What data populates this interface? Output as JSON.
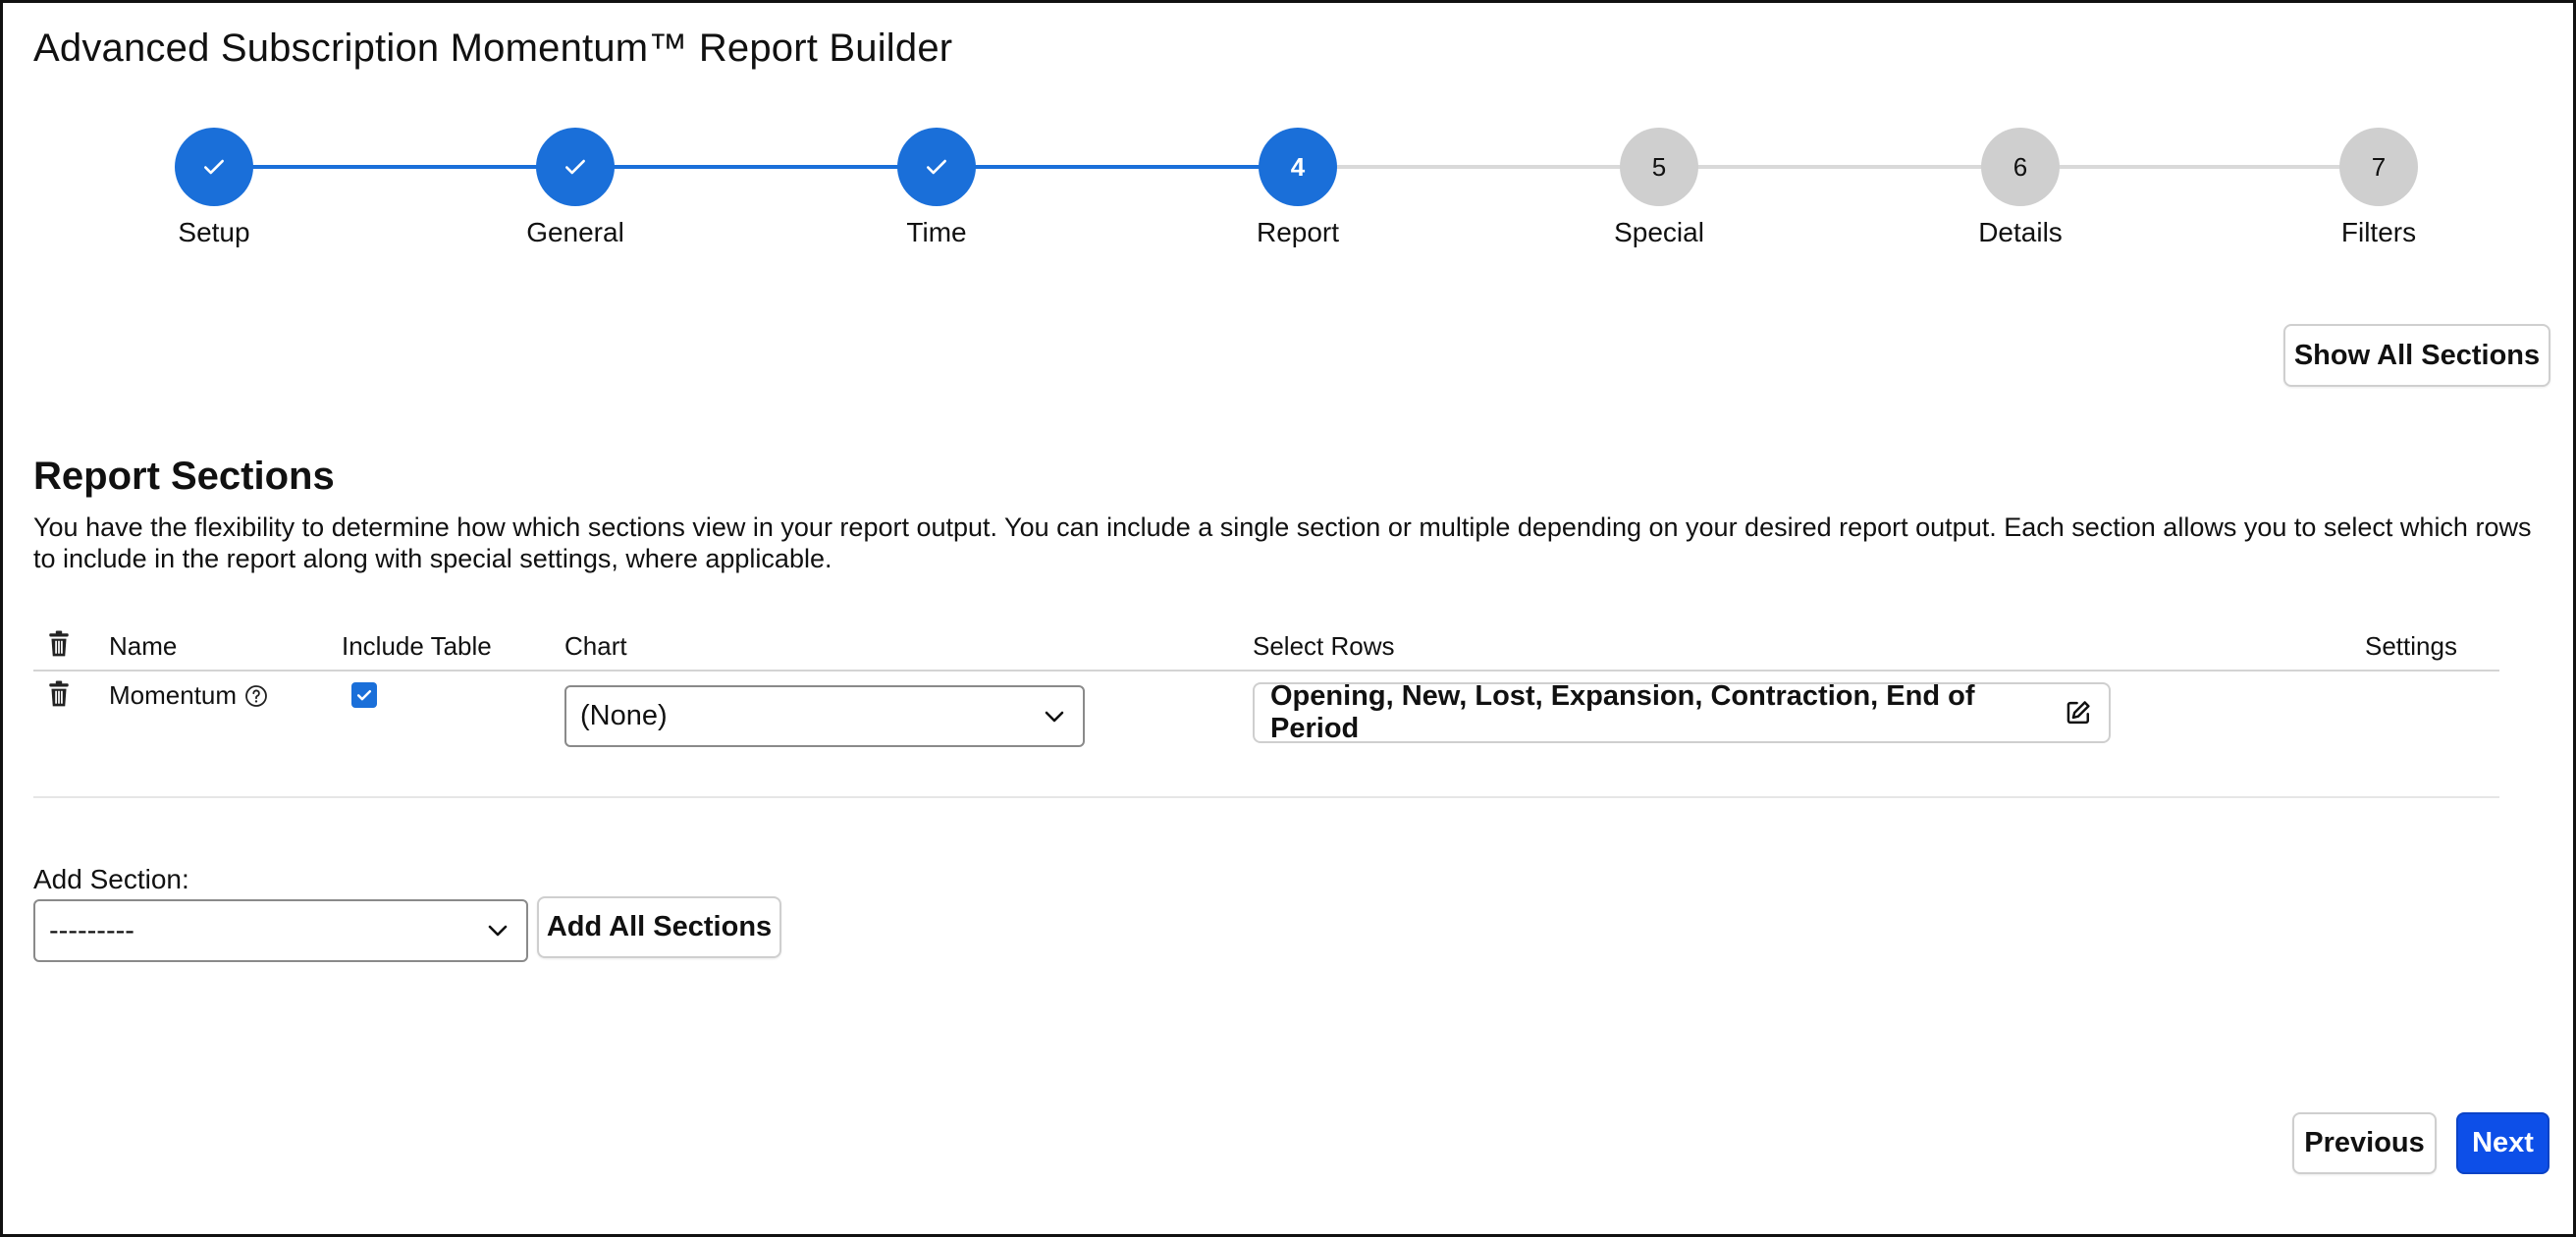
{
  "app": {
    "title": "Advanced Subscription Momentum™ Report Builder"
  },
  "stepper": {
    "steps": [
      {
        "number": "1",
        "label": "Setup",
        "state": "done"
      },
      {
        "number": "2",
        "label": "General",
        "state": "done"
      },
      {
        "number": "3",
        "label": "Time",
        "state": "done"
      },
      {
        "number": "4",
        "label": "Report",
        "state": "active"
      },
      {
        "number": "5",
        "label": "Special",
        "state": "todo"
      },
      {
        "number": "6",
        "label": "Details",
        "state": "todo"
      },
      {
        "number": "7",
        "label": "Filters",
        "state": "todo"
      }
    ]
  },
  "toolbar": {
    "show_all_label": "Show All Sections"
  },
  "report_sections": {
    "title": "Report Sections",
    "description": "You have the flexibility to determine how which sections view in your report output. You can include a single section or multiple depending on your desired report output. Each section allows you to select which rows to include in the report along with special settings, where applicable.",
    "columns": {
      "name": "Name",
      "include_table": "Include Table",
      "chart": "Chart",
      "select_rows": "Select Rows",
      "settings": "Settings"
    },
    "rows": [
      {
        "name": "Momentum",
        "include_table": true,
        "chart": "(None)",
        "select_rows": "Opening, New, Lost, Expansion, Contraction, End of Period"
      }
    ]
  },
  "add_section": {
    "label": "Add Section:",
    "selected": "---------",
    "add_all_label": "Add All Sections"
  },
  "footer": {
    "previous_label": "Previous",
    "next_label": "Next"
  },
  "colors": {
    "accent": "#1a6fd9",
    "pending": "#cfcfcf",
    "primary_button": "#0d4fe8"
  }
}
